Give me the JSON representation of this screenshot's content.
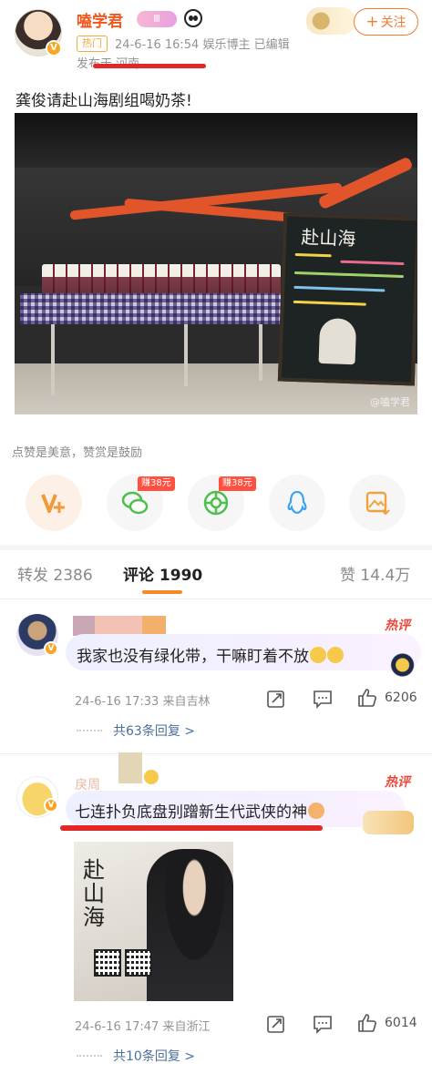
{
  "post": {
    "username": "嗑学君",
    "level_badge": "Ⅲ",
    "hot_tag": "热门",
    "meta": "24-6-16 16:54   娱乐博主   已编辑",
    "location": "发布于 河南",
    "follow_label": "关注",
    "follow_plus": "+",
    "text": "龚俊请赴山海剧组喝奶茶!",
    "photo": {
      "board_title": "赴山海",
      "watermark": "@嗑学君"
    }
  },
  "reward": {
    "prompt": "点赞是美意，赞赏是鼓励",
    "buttons": [
      {
        "icon": "v-plus-icon",
        "badge": ""
      },
      {
        "icon": "wechat-icon",
        "badge": "赚38元"
      },
      {
        "icon": "moments-icon",
        "badge": "赚38元"
      },
      {
        "icon": "qq-icon",
        "badge": ""
      },
      {
        "icon": "save-image-icon",
        "badge": ""
      }
    ]
  },
  "tabs": {
    "repost": "转发 2386",
    "comment": "评论 1990",
    "like": "赞 14.4万"
  },
  "comments": [
    {
      "hot_label": "热评",
      "text": "我家也没有绿化带，干嘛盯着不放",
      "meta": "24-6-16 17:33  来自吉林",
      "likes": "6206",
      "replies": "共63条回复 >"
    },
    {
      "hot_label": "热评",
      "name_partial": "戾周",
      "text": "七连扑负底盘别蹭新生代武侠的神",
      "meta": "24-6-16 17:47  来自浙江",
      "likes": "6014",
      "replies": "共10条回复 >",
      "poster_title": "赴山海"
    }
  ],
  "colors": {
    "accent": "#f27b32",
    "username": "#f0571f",
    "hot": "#e84b3d",
    "link": "#4b6f9d",
    "red_mark": "#e32726"
  }
}
